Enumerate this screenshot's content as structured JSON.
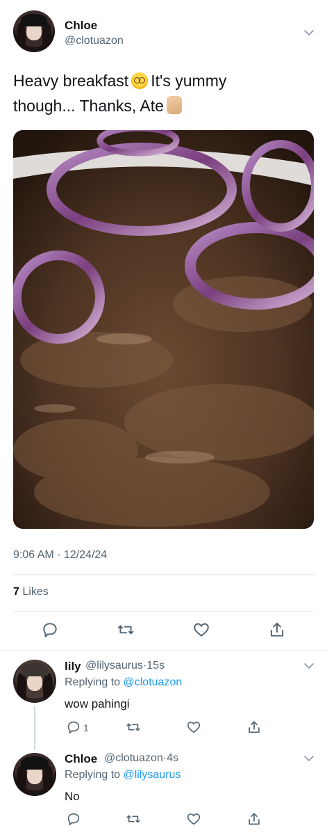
{
  "tweet": {
    "author_name": "Chloe",
    "author_handle": "@clotuazon",
    "text_line1": "Heavy breakfast",
    "text_line1_rest": "It's yummy",
    "text_line2": "though... Thanks, Ate",
    "emoji_1": "woozy-face-emoji",
    "emoji_2": "thumbs-up-emoji",
    "time": "9:06 AM · 12/24/24",
    "likes_count": "7",
    "likes_label": "Likes"
  },
  "replies": [
    {
      "author_name": "lily",
      "author_handle": "@lilysaurus",
      "time_sep": "·",
      "time": "15s",
      "replying_to_label": "Replying to",
      "replying_to_handle": "@clotuazon",
      "text": "wow pahingi",
      "reply_count": "1"
    },
    {
      "author_name": "Chloe",
      "author_handle": "@clotuazon",
      "time_sep": "·",
      "time": "4s",
      "replying_to_label": "Replying to",
      "replying_to_handle": "@lilysaurus",
      "text": "No"
    }
  ],
  "icons": {
    "reply": "reply-icon",
    "retweet": "retweet-icon",
    "like": "heart-icon",
    "share": "share-icon",
    "more": "chevron-down-icon"
  },
  "colors": {
    "text": "#0f1419",
    "secondary": "#536471",
    "link": "#1d9bf0",
    "divider": "#e6e9ec"
  }
}
